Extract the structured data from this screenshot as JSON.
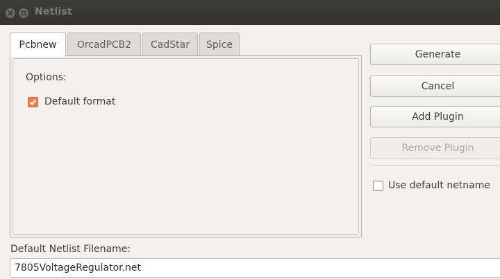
{
  "window": {
    "title": "Netlist",
    "close_icon": "close-icon",
    "minimize_icon": "minimize-icon"
  },
  "tabs": [
    {
      "label": "Pcbnew",
      "active": true
    },
    {
      "label": "OrcadPCB2",
      "active": false
    },
    {
      "label": "CadStar",
      "active": false
    },
    {
      "label": "Spice",
      "active": false
    }
  ],
  "options": {
    "heading": "Options:",
    "default_format": {
      "label": "Default format",
      "checked": true
    }
  },
  "buttons": {
    "generate": "Generate",
    "cancel": "Cancel",
    "add_plugin": "Add Plugin",
    "remove_plugin": {
      "label": "Remove Plugin",
      "enabled": false
    }
  },
  "use_default_netname": {
    "label": "Use default netname",
    "checked": false
  },
  "filename": {
    "label": "Default Netlist Filename:",
    "value": "7805VoltageRegulator.net"
  },
  "colors": {
    "titlebar": "#3a3935",
    "accent_checkbox": "#f08050",
    "window_bg": "#f2f1f0"
  }
}
